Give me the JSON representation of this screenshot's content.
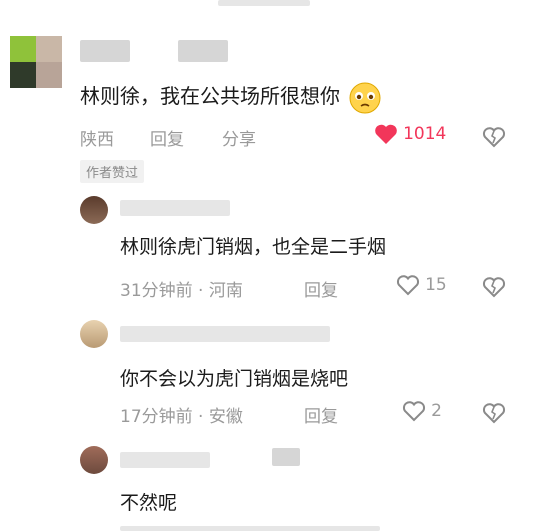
{
  "top_comment": {
    "text": "林则徐，我在公共场所很想你",
    "location": "陕西",
    "reply_label": "回复",
    "share_label": "分享",
    "likes": "1014",
    "author_badge": "作者赞过"
  },
  "replies": [
    {
      "text": "林则徐虎门销烟，也全是二手烟",
      "time_location": "31分钟前 · 河南",
      "reply_label": "回复",
      "likes": "15"
    },
    {
      "text": "你不会以为虎门销烟是烧吧",
      "time_location": "17分钟前 · 安徽",
      "reply_label": "回复",
      "likes": "2"
    },
    {
      "text": "不然呢"
    }
  ],
  "colors": {
    "liked_heart": "#f2365a",
    "meta_gray": "#9a9a9a"
  },
  "icons": [
    "heart-filled-icon",
    "heart-outline-icon",
    "broken-heart-icon",
    "worried-face-emoji"
  ]
}
